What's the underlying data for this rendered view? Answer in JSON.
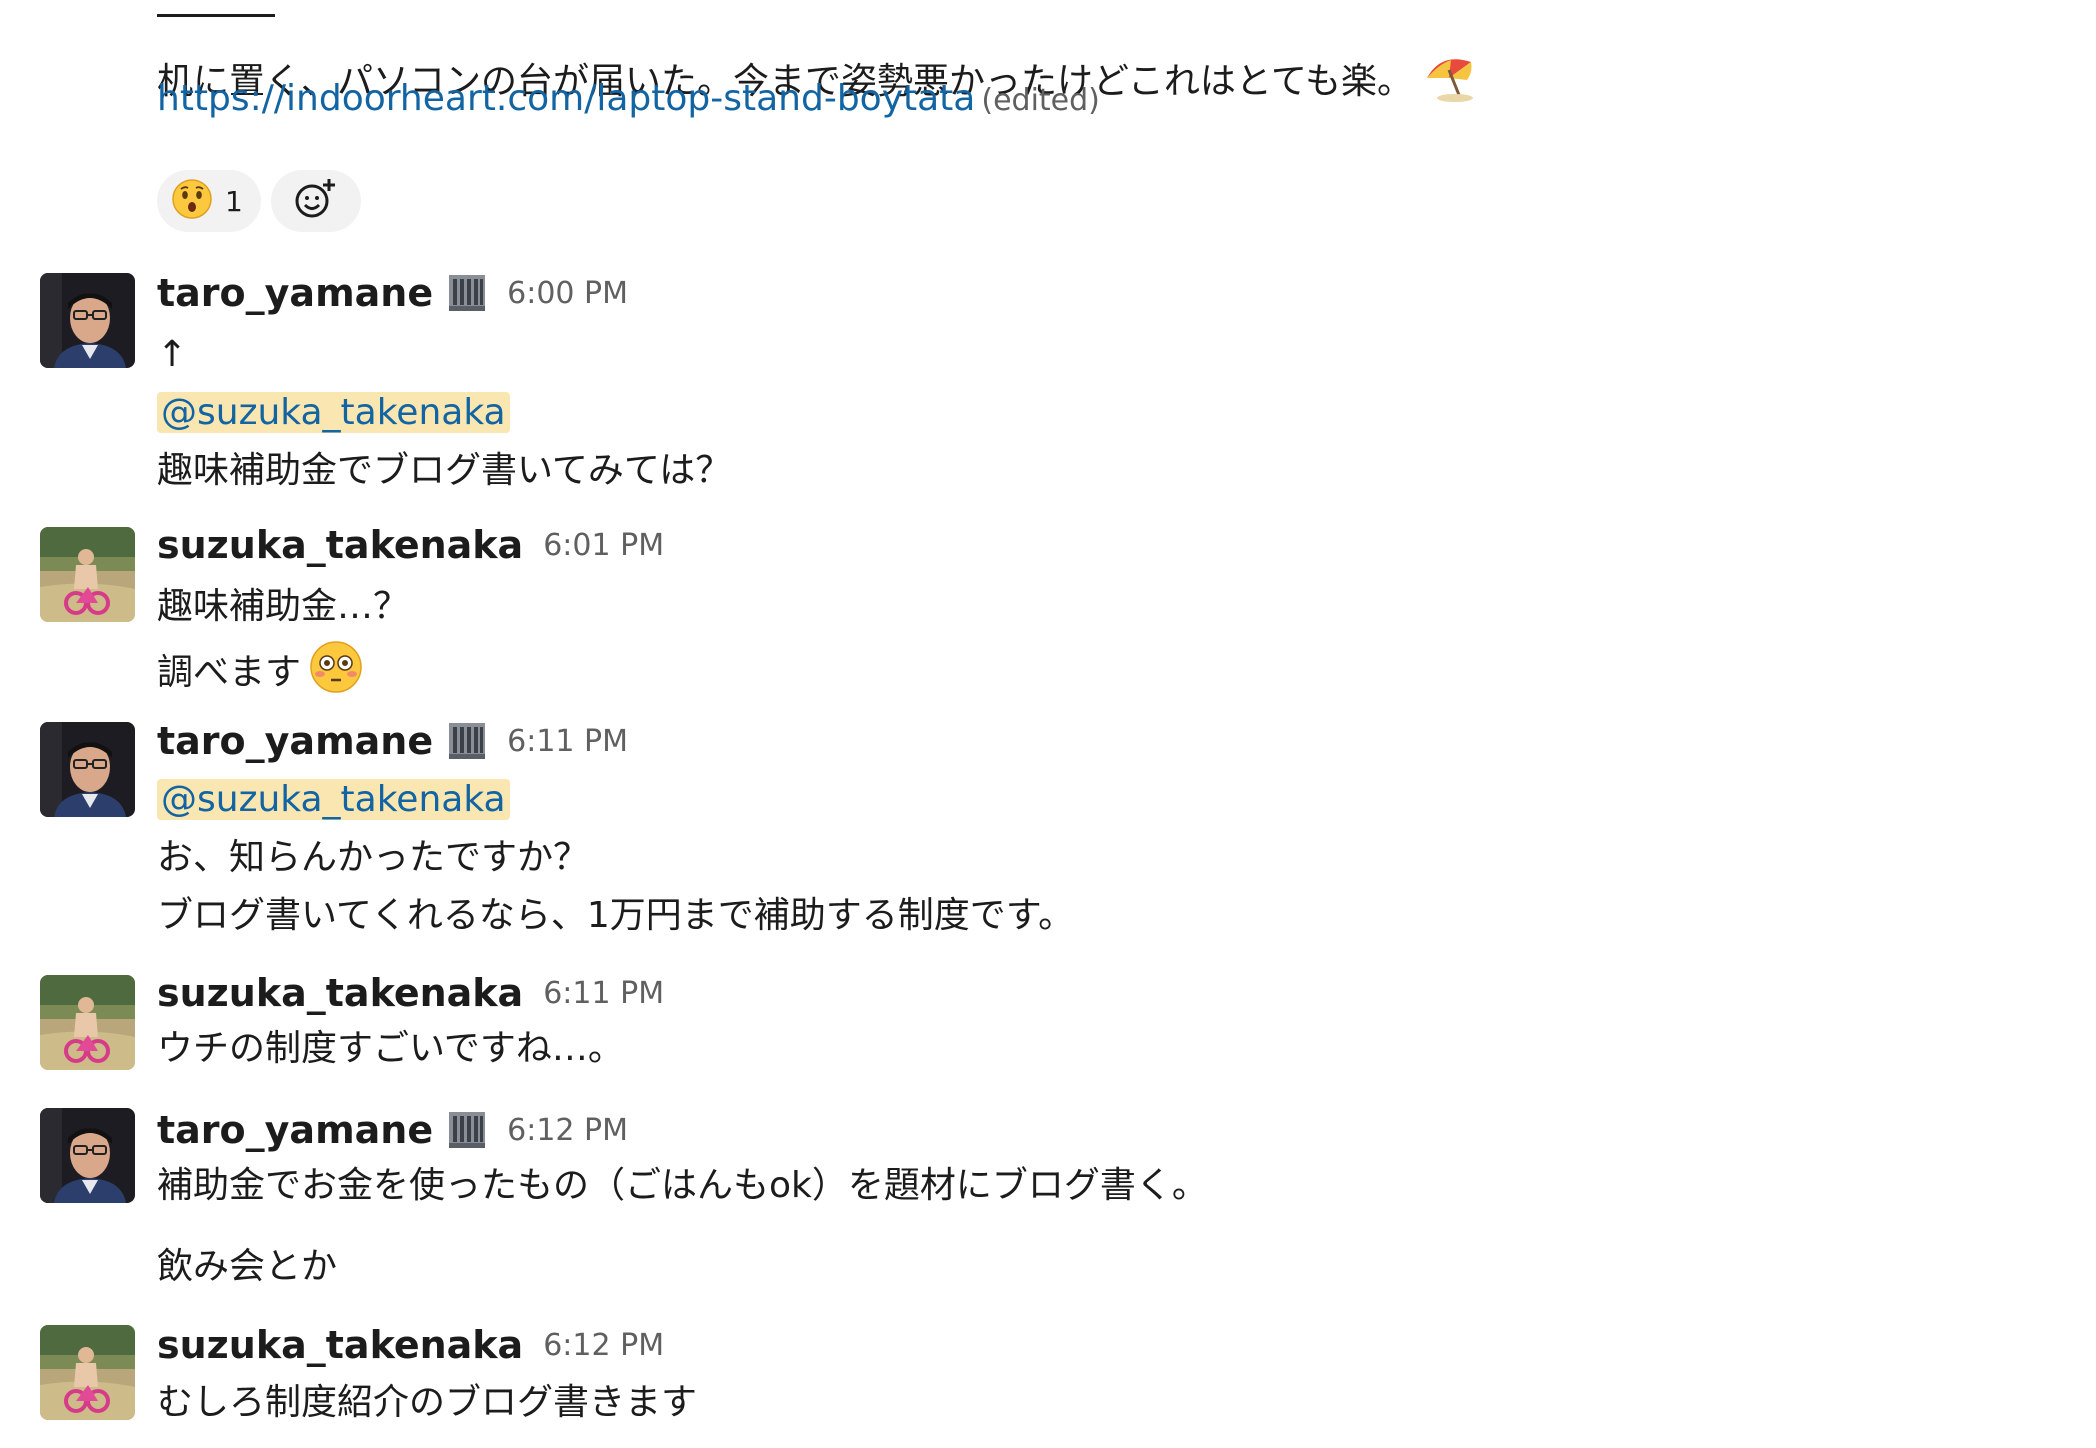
{
  "messages": [
    {
      "lines": [
        "机に置く、パソコンの台が届いた。今まで姿勢悪かったけどこれはとても楽。",
        "https://indoorheart.com/laptop-stand-boytata"
      ],
      "edited_label": "(edited)",
      "trailing_emoji": "umbrella-on-ground-emoji",
      "reactions": [
        {
          "emoji": "hushed-face-emoji",
          "count": "1"
        },
        {
          "emoji": "add-reaction-icon"
        }
      ]
    },
    {
      "user": "taro_yamane",
      "status_emoji": "office-building-emoji",
      "time": "6:00 PM",
      "lines": [
        "↑",
        "@suzuka_takenaka",
        "趣味補助金でブログ書いてみては？"
      ]
    },
    {
      "user": "suzuka_takenaka",
      "time": "6:01 PM",
      "lines": [
        "趣味補助金…？",
        "調べます"
      ],
      "trailing_emoji": "flushed-face-emoji"
    },
    {
      "user": "taro_yamane",
      "status_emoji": "office-building-emoji",
      "time": "6:11 PM",
      "lines": [
        "@suzuka_takenaka",
        "お、知らんかったですか？",
        "ブログ書いてくれるなら、1万円まで補助する制度です。"
      ]
    },
    {
      "user": "suzuka_takenaka",
      "time": "6:11 PM",
      "lines": [
        "ウチの制度すごいですね…。"
      ]
    },
    {
      "user": "taro_yamane",
      "status_emoji": "office-building-emoji",
      "time": "6:12 PM",
      "lines": [
        "補助金でお金を使ったもの（ごはんもok）を題材にブログ書く。",
        "飲み会とか"
      ]
    },
    {
      "user": "suzuka_takenaka",
      "time": "6:12 PM",
      "lines": [
        "むしろ制度紹介のブログ書きます"
      ]
    }
  ],
  "colors": {
    "link": "#1264a3",
    "mention_bg": "#f9e6b1",
    "timestamp": "#616061",
    "reaction_bg": "#f2f2f2"
  }
}
